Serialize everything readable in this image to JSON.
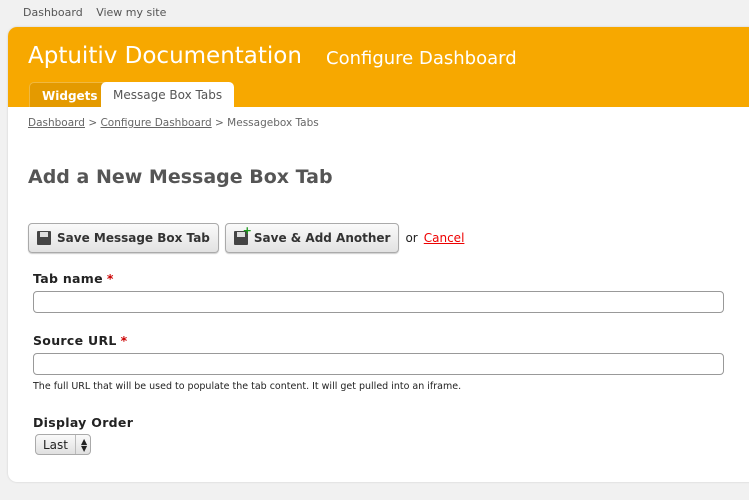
{
  "topnav": {
    "dashboard": "Dashboard",
    "view_site": "View my site"
  },
  "header": {
    "title": "Aptuitiv Documentation",
    "subtitle": "Configure Dashboard"
  },
  "tabs": [
    {
      "label": "Widgets"
    },
    {
      "label": "Message Box Tabs",
      "active": true
    }
  ],
  "breadcrumb": {
    "items": [
      "Dashboard",
      "Configure Dashboard",
      "Messagebox Tabs"
    ],
    "sep": ">"
  },
  "page": {
    "heading": "Add a New Message Box Tab"
  },
  "buttons": {
    "save": "Save Message Box Tab",
    "save_add": "Save & Add Another",
    "or": "or",
    "cancel": "Cancel"
  },
  "form": {
    "tab_name": {
      "label": "Tab name",
      "required": "*",
      "value": ""
    },
    "source_url": {
      "label": "Source URL",
      "required": "*",
      "value": "",
      "help": "The full URL that will be used to populate the tab content. It will get pulled into an iframe."
    },
    "display_order": {
      "label": "Display Order",
      "value": "Last"
    }
  },
  "colors": {
    "accent": "#f7a800",
    "cancel": "#ee0000"
  }
}
